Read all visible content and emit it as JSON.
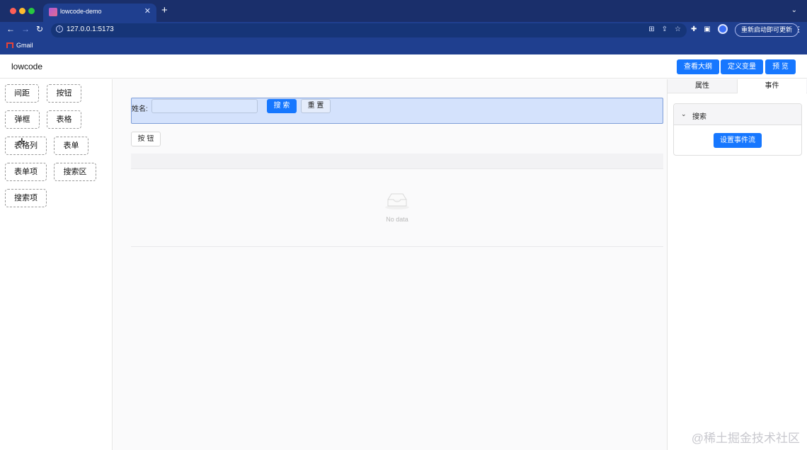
{
  "browser": {
    "tab_title": "lowcode-demo",
    "tab_close": "✕",
    "new_tab": "+",
    "tab_menu": "⌄",
    "url": "127.0.0.1:5173",
    "update_label": "重新启动即可更新",
    "update_more": "⋮",
    "bookmarks": [
      "Gmail"
    ]
  },
  "app": {
    "logo": "lowcode",
    "header_buttons": [
      "查看大纲",
      "定义变量",
      "预 览"
    ]
  },
  "components": [
    "间距",
    "按钮",
    "弹框",
    "表格",
    "表格列",
    "表单",
    "表单项",
    "搜索区",
    "搜索项"
  ],
  "canvas": {
    "search_label": "姓名:",
    "search_input_value": "",
    "search_button": "搜 索",
    "reset_button": "重 置",
    "button_label": "按 钮",
    "empty_text": "No data"
  },
  "right_panel": {
    "tabs": [
      "属性",
      "事件"
    ],
    "active_tab": "事件",
    "section_title": "搜索",
    "flow_button": "设置事件流"
  },
  "watermark": "@稀土掘金技术社区",
  "colors": {
    "primary": "#1677ff",
    "browser_bar": "#1f3f8f",
    "selected_bg": "#d4e2fc"
  }
}
